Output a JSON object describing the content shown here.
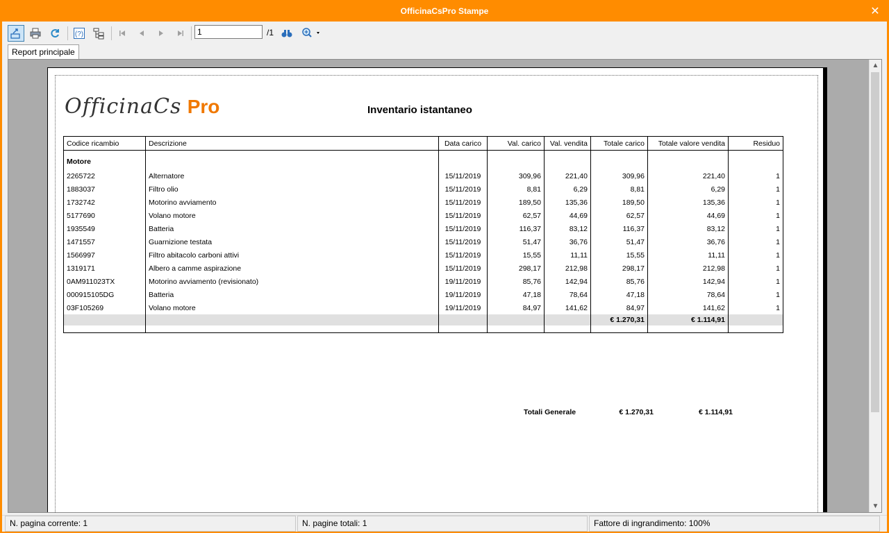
{
  "window": {
    "title": "OfficinaCsPro Stampe",
    "close_icon": "close-icon",
    "accent_color": "#ff8c00"
  },
  "toolbar": {
    "buttons": [
      "export-icon",
      "print-icon",
      "refresh-icon",
      "help-icon",
      "tree-icon",
      "first-page-icon",
      "previous-page-icon",
      "next-page-icon",
      "last-page-icon",
      "search-icon",
      "zoom-icon"
    ],
    "page_value": "1",
    "page_total": "/1"
  },
  "tabs": [
    {
      "label": "Report principale"
    }
  ],
  "report": {
    "logo_script": "OfficinaCs",
    "logo_pro": "Pro",
    "logo_pro_color": "#f07800",
    "title": "Inventario istantaneo",
    "columns": [
      "Codice ricambio",
      "Descrizione",
      "Data carico",
      "Val. carico",
      "Val. vendita",
      "Totale carico",
      "Totale valore vendita",
      "Residuo"
    ],
    "group": "Motore",
    "rows": [
      [
        "2265722",
        "Alternatore",
        "15/11/2019",
        "309,96",
        "221,40",
        "309,96",
        "221,40",
        "1"
      ],
      [
        "1883037",
        "Filtro olio",
        "15/11/2019",
        "8,81",
        "6,29",
        "8,81",
        "6,29",
        "1"
      ],
      [
        "1732742",
        "Motorino avviamento",
        "15/11/2019",
        "189,50",
        "135,36",
        "189,50",
        "135,36",
        "1"
      ],
      [
        "5177690",
        "Volano motore",
        "15/11/2019",
        "62,57",
        "44,69",
        "62,57",
        "44,69",
        "1"
      ],
      [
        "1935549",
        "Batteria",
        "15/11/2019",
        "116,37",
        "83,12",
        "116,37",
        "83,12",
        "1"
      ],
      [
        "1471557",
        "Guarnizione testata",
        "15/11/2019",
        "51,47",
        "36,76",
        "51,47",
        "36,76",
        "1"
      ],
      [
        "1566997",
        "Filtro abitacolo carboni attivi",
        "15/11/2019",
        "15,55",
        "11,11",
        "15,55",
        "11,11",
        "1"
      ],
      [
        "1319171",
        "Albero a camme aspirazione",
        "15/11/2019",
        "298,17",
        "212,98",
        "298,17",
        "212,98",
        "1"
      ],
      [
        "0AM911023TX",
        "Motorino avviamento (revisionato)",
        "19/11/2019",
        "85,76",
        "142,94",
        "85,76",
        "142,94",
        "1"
      ],
      [
        "000915105DG",
        "Batteria",
        "19/11/2019",
        "47,18",
        "78,64",
        "47,18",
        "78,64",
        "1"
      ],
      [
        "03F105269",
        "Volano motore",
        "19/11/2019",
        "84,97",
        "141,62",
        "84,97",
        "141,62",
        "1"
      ]
    ],
    "subtotal_carico": "€ 1.270,31",
    "subtotal_vendita": "€ 1.114,91",
    "grand_label": "Totali Generale",
    "grand_carico": "€ 1.270,31",
    "grand_vendita": "€ 1.114,91"
  },
  "status": {
    "current_page": "N. pagina corrente: 1",
    "total_pages": "N. pagine totali: 1",
    "zoom": "Fattore di ingrandimento: 100%"
  }
}
